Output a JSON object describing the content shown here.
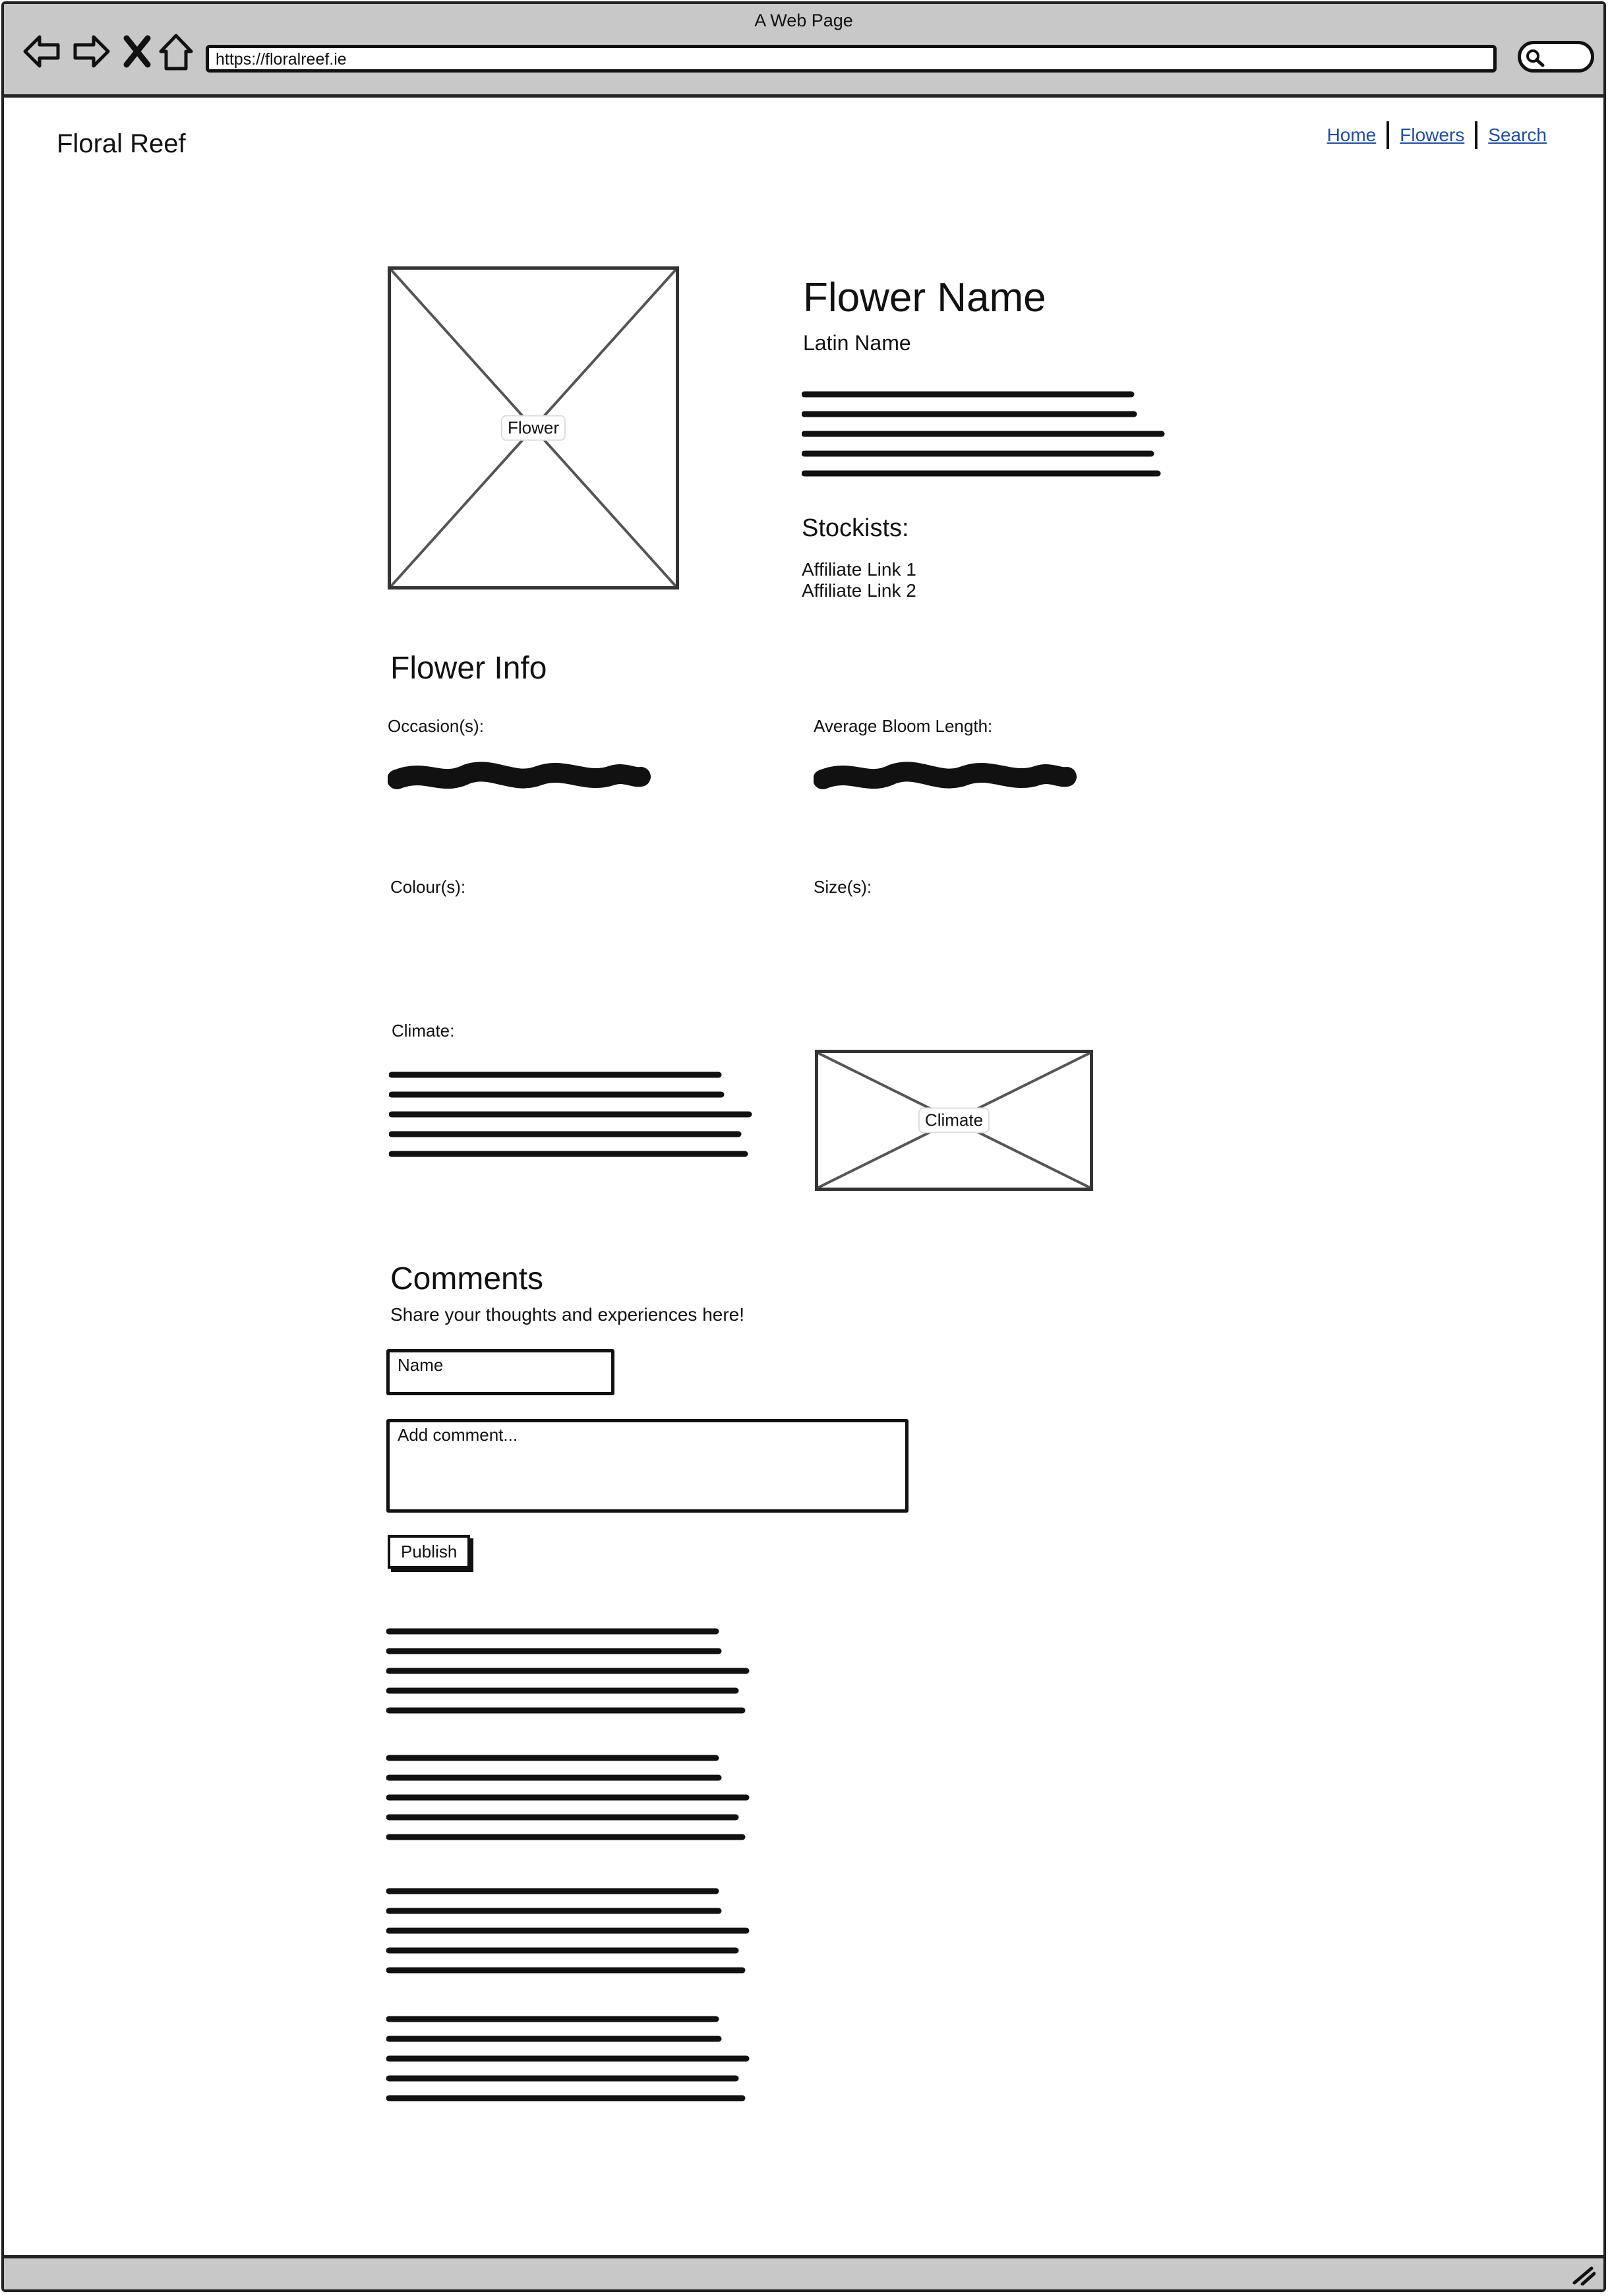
{
  "browser": {
    "window_title": "A Web Page",
    "url": "https://floralreef.ie"
  },
  "site": {
    "logo": "Floral Reef",
    "nav": [
      "Home",
      "Flowers",
      "Search"
    ]
  },
  "flower": {
    "image_caption": "Flower",
    "name": "Flower Name",
    "latin_name": "Latin Name",
    "stockists_heading": "Stockists:",
    "stockists": [
      "Affiliate Link 1",
      "Affiliate Link 2"
    ]
  },
  "info": {
    "heading": "Flower Info",
    "occasions_label": "Occasion(s):",
    "bloom_label": "Average Bloom Length:",
    "colours_label": "Colour(s):",
    "sizes_label": "Size(s):",
    "climate_label": "Climate:",
    "climate_image_caption": "Climate"
  },
  "comments": {
    "heading": "Comments",
    "subheading": "Share your thoughts and experiences here!",
    "name_placeholder": "Name",
    "comment_placeholder": "Add comment...",
    "publish_label": "Publish"
  },
  "icons": [
    "back-arrow-icon",
    "forward-arrow-icon",
    "close-icon",
    "home-icon",
    "search-icon",
    "resize-grip-icon"
  ]
}
